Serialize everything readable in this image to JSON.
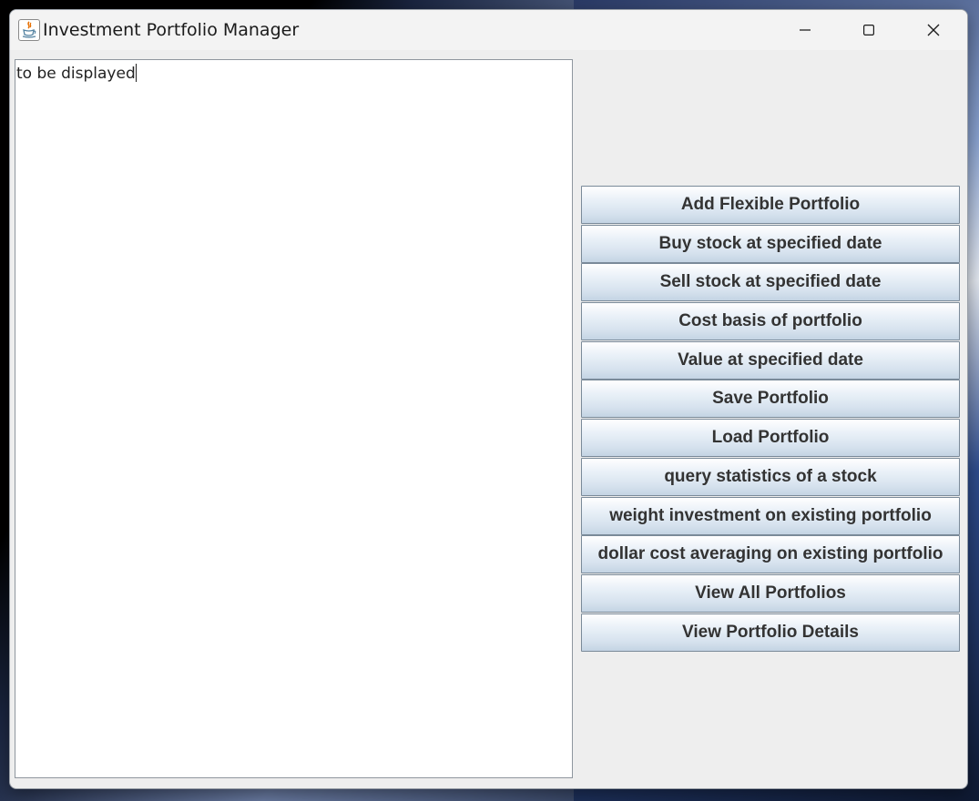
{
  "window": {
    "title": "Investment Portfolio Manager",
    "controls": [
      "minimize",
      "maximize",
      "close"
    ]
  },
  "output_area": {
    "text": "to be displayed"
  },
  "buttons": [
    {
      "label": "Add Flexible Portfolio"
    },
    {
      "label": "Buy stock at specified date"
    },
    {
      "label": "Sell stock at specified date"
    },
    {
      "label": "Cost basis of portfolio"
    },
    {
      "label": "Value at specified date"
    },
    {
      "label": "Save Portfolio"
    },
    {
      "label": "Load Portfolio"
    },
    {
      "label": "query statistics of a stock"
    },
    {
      "label": "weight investment on existing portfolio"
    },
    {
      "label": "dollar cost averaging on existing portfolio"
    },
    {
      "label": "View All Portfolios"
    },
    {
      "label": "View Portfolio Details"
    }
  ],
  "icons": {
    "app": "java-coffee-cup-icon",
    "minimize": "minimize-icon",
    "maximize": "maximize-icon",
    "close": "close-icon"
  },
  "colors": {
    "window_bg": "#eeeeee",
    "button_top": "#ffffff",
    "button_bottom": "#c4d4e4",
    "button_border": "#7a8a99",
    "button_text": "#333333"
  }
}
